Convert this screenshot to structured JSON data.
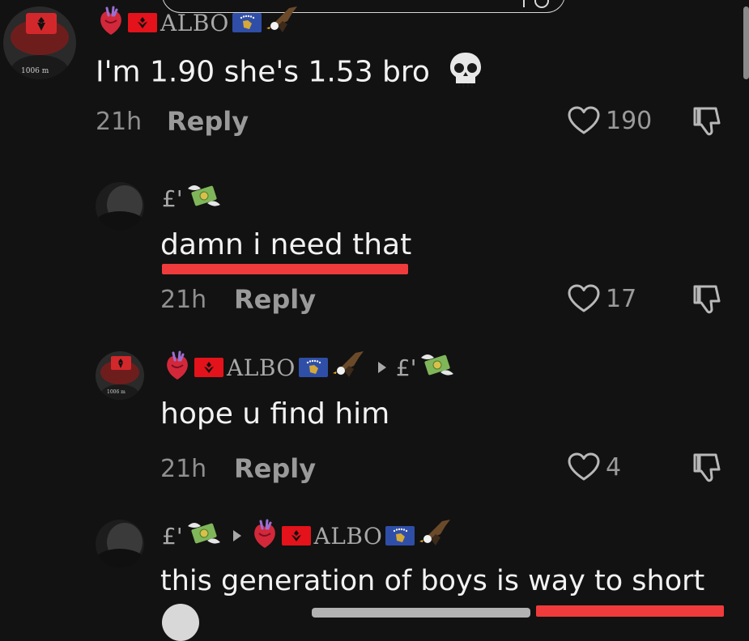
{
  "comments": [
    {
      "username_parts": [
        "ALBO"
      ],
      "text": "I'm 1.90 she's 1.53 bro",
      "time": "21h",
      "reply_label": "Reply",
      "likes": "190"
    },
    {
      "username_parts": [
        "£'"
      ],
      "text": "damn i need that",
      "time": "21h",
      "reply_label": "Reply",
      "likes": "17"
    },
    {
      "username_parts": [
        "ALBO",
        "£'"
      ],
      "text": "hope u find him",
      "time": "21h",
      "reply_label": "Reply",
      "likes": "4"
    },
    {
      "username_parts": [
        "£'",
        "ALBO"
      ],
      "text": "this generation of boys is way to short"
    }
  ],
  "colors": {
    "background": "#121212",
    "accent_red": "#ef3b3b",
    "muted": "#9a9a9a"
  },
  "icons": [
    "heart-icon",
    "dislike-icon",
    "skull-emoji",
    "anatomical-heart-emoji",
    "albania-flag",
    "kosovo-flag",
    "eagle-emoji",
    "money-wings-emoji",
    "reply-arrow-icon",
    "search-icon"
  ]
}
